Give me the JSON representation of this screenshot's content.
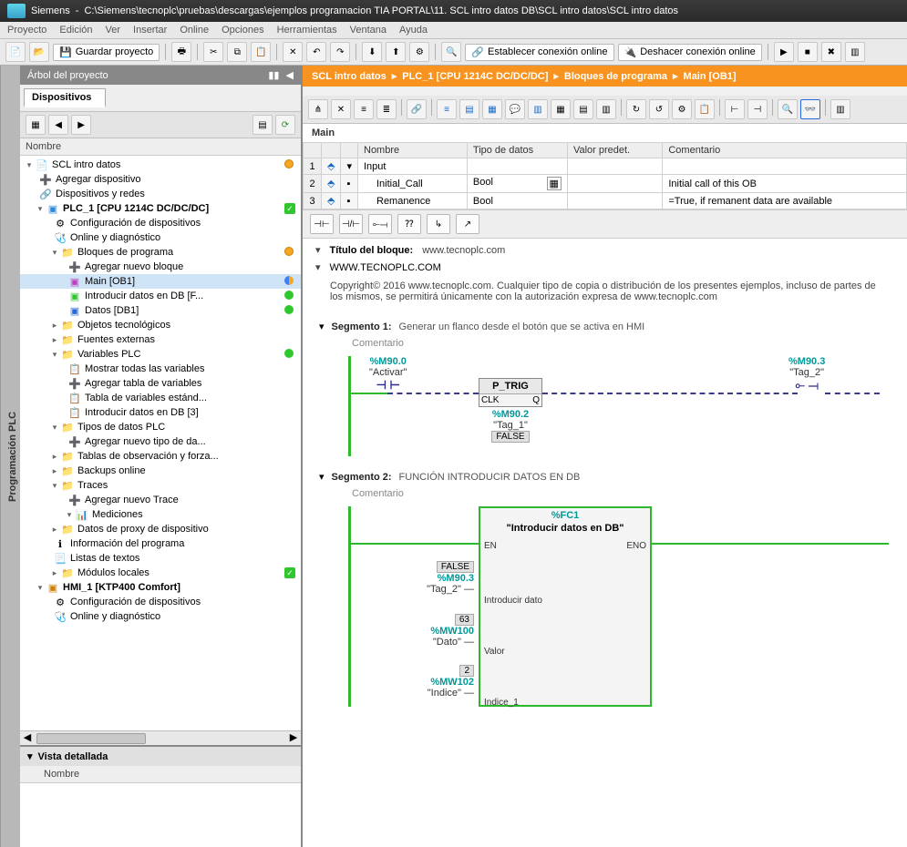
{
  "title_bar": {
    "app": "Siemens",
    "path": "C:\\Siemens\\tecnoplc\\pruebas\\descargas\\ejemplos programacion TIA PORTAL\\11. SCL intro datos DB\\SCL intro datos\\SCL intro datos"
  },
  "menu": {
    "items": [
      "Proyecto",
      "Edición",
      "Ver",
      "Insertar",
      "Online",
      "Opciones",
      "Herramientas",
      "Ventana",
      "Ayuda"
    ]
  },
  "toolbar": {
    "save_label": "Guardar proyecto",
    "go_online": "Establecer conexión online",
    "go_offline": "Deshacer conexión online"
  },
  "project_panel": {
    "title": "Árbol del proyecto",
    "devices_tab": "Dispositivos",
    "name_col": "Nombre",
    "detail": "Vista detallada",
    "detail_name": "Nombre"
  },
  "tree": {
    "root": "SCL intro datos",
    "add_device": "Agregar dispositivo",
    "devices_networks": "Dispositivos y redes",
    "plc": "PLC_1 [CPU 1214C DC/DC/DC]",
    "dev_config": "Configuración de dispositivos",
    "online_diag": "Online y diagnóstico",
    "program_blocks": "Bloques de programa",
    "add_block": "Agregar nuevo bloque",
    "main_ob1": "Main [OB1]",
    "intro_db": "Introducir datos en DB [F...",
    "datos_db1": "Datos [DB1]",
    "tech_obj": "Objetos tecnológicos",
    "ext_src": "Fuentes externas",
    "plc_vars": "Variables PLC",
    "show_all_vars": "Mostrar todas las variables",
    "add_var_table": "Agregar tabla de variables",
    "std_var_table": "Tabla de variables estánd...",
    "intro_db3": "Introducir datos en DB [3]",
    "plc_types": "Tipos de datos PLC",
    "add_type": "Agregar nuevo tipo de da...",
    "watch_tables": "Tablas de observación y forza...",
    "backups": "Backups online",
    "traces": "Traces",
    "add_trace": "Agregar nuevo Trace",
    "measurements": "Mediciones",
    "proxy_data": "Datos de proxy de dispositivo",
    "prog_info": "Información del programa",
    "text_lists": "Listas de textos",
    "local_modules": "Módulos locales",
    "hmi": "HMI_1 [KTP400 Comfort]",
    "hmi_config": "Configuración de dispositivos",
    "hmi_online": "Online y diagnóstico"
  },
  "breadcrumb": {
    "p1": "SCL intro datos",
    "p2": "PLC_1 [CPU 1214C DC/DC/DC]",
    "p3": "Bloques de programa",
    "p4": "Main [OB1]"
  },
  "editor": {
    "title": "Main",
    "cols": {
      "name": "Nombre",
      "type": "Tipo de datos",
      "default": "Valor predet.",
      "comment": "Comentario"
    },
    "rows": [
      {
        "n": "1",
        "name": "Input",
        "type": "",
        "default": "",
        "comment": ""
      },
      {
        "n": "2",
        "name": "Initial_Call",
        "type": "Bool",
        "default": "",
        "comment": "Initial call of this OB"
      },
      {
        "n": "3",
        "name": "Remanence",
        "type": "Bool",
        "default": "",
        "comment": "=True, if remanent data are available"
      }
    ],
    "block_title_label": "Título del bloque:",
    "block_title": "www.tecnoplc.com",
    "block_site": "WWW.TECNOPLC.COM",
    "copyright": "Copyright© 2016 www.tecnoplc.com. Cualquier tipo de copia o distribución de los presentes ejemplos, incluso de partes de los mismos, se permitirá únicamente con la autorización expresa de   www.tecnoplc.com",
    "seg1": {
      "label": "Segmento 1:",
      "desc": "Generar un flanco desde el botón que se activa en HMI",
      "comment": "Comentario",
      "activar_addr": "%M90.0",
      "activar_name": "\"Activar\"",
      "ptrig": "P_TRIG",
      "clk": "CLK",
      "q": "Q",
      "tag1_addr": "%M90.2",
      "tag1_name": "\"Tag_1\"",
      "tag1_val": "FALSE",
      "tag2_addr": "%M90.3",
      "tag2_name": "\"Tag_2\""
    },
    "seg2": {
      "label": "Segmento 2:",
      "desc": "FUNCIÓN INTRODUCIR DATOS EN DB",
      "comment": "Comentario",
      "fc_addr": "%FC1",
      "fc_name": "\"Introducir datos en DB\"",
      "en": "EN",
      "eno": "ENO",
      "p1_val": "FALSE",
      "p1_addr": "%M90.3",
      "p1_name": "\"Tag_2\"",
      "p1_pin": "Introducir dato",
      "p2_val": "63",
      "p2_addr": "%MW100",
      "p2_name": "\"Dato\"",
      "p2_pin": "Valor",
      "p3_val": "2",
      "p3_addr": "%MW102",
      "p3_name": "\"Indice\"",
      "p3_pin": "Indice_1"
    }
  },
  "side_tab": "Programación PLC"
}
